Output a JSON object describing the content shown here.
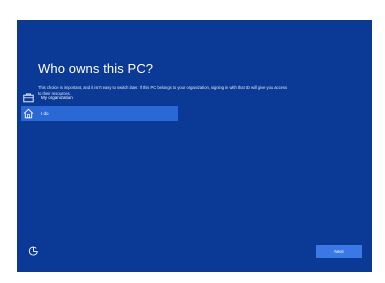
{
  "setup": {
    "title": "Who owns this PC?",
    "description": "This choice is important, and it isn't easy to switch later. If this PC belongs to your organization, signing in with that ID will give you access to their resources.",
    "options": [
      {
        "label": "My organization",
        "icon": "briefcase-icon",
        "selected": false
      },
      {
        "label": "I do",
        "icon": "home-icon",
        "selected": true
      }
    ],
    "accessibility_icon": "ease-of-access-icon",
    "next_label": "Next"
  },
  "colors": {
    "background": "#0b3a96",
    "selected_option": "#2a68d6",
    "button": "#3a78e6",
    "text": "#ffffff"
  }
}
